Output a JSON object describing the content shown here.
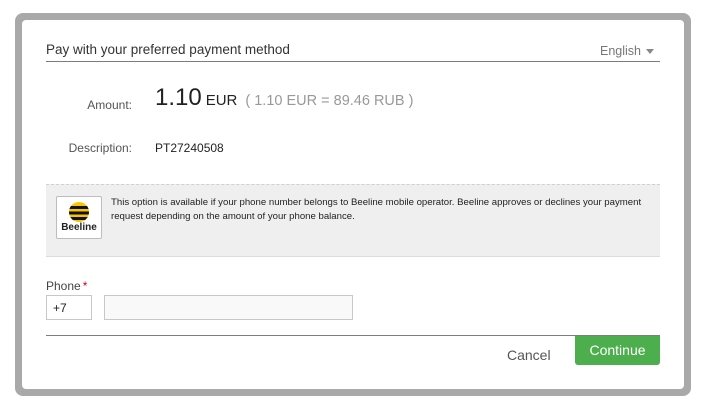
{
  "header": {
    "title": "Pay with your preferred payment method",
    "language": "English"
  },
  "amount": {
    "label": "Amount:",
    "value": "1.10",
    "currency": "EUR",
    "conversion": "( 1.10 EUR = 89.46 RUB )"
  },
  "description": {
    "label": "Description:",
    "value": "PT27240508"
  },
  "payment_method": {
    "logo_text": "Beeline",
    "logo_icon": "beeline-logo-icon",
    "info_text": "This option is available if your phone number belongs to Beeline mobile operator. Beeline approves or declines your payment request depending on the amount of your phone balance."
  },
  "phone": {
    "label": "Phone",
    "required_mark": "*",
    "country_code": "+7",
    "number_value": "",
    "number_placeholder": ""
  },
  "actions": {
    "cancel_label": "Cancel",
    "continue_label": "Continue"
  },
  "colors": {
    "continue_button": "#4cae4c",
    "required_mark": "#d0021b",
    "frame": "#a9a9a9"
  }
}
